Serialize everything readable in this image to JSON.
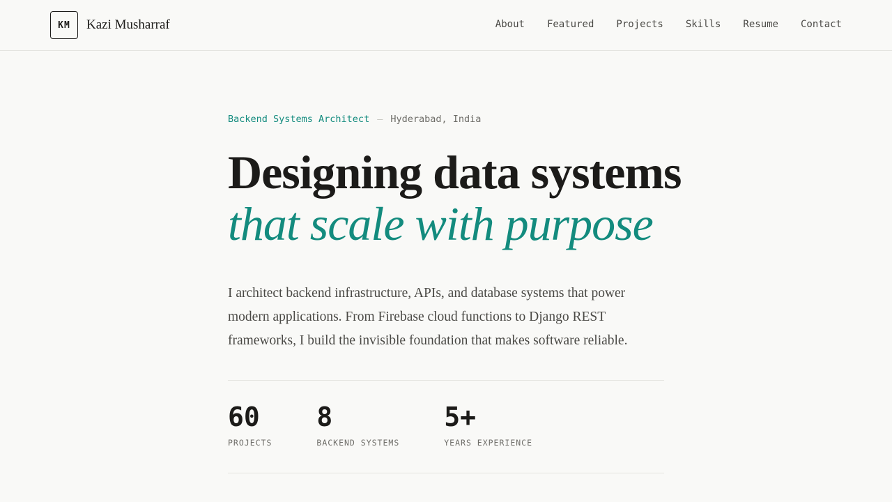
{
  "header": {
    "logo_initials": "KM",
    "logo_name": "Kazi Musharraf",
    "nav": [
      {
        "label": "About"
      },
      {
        "label": "Featured"
      },
      {
        "label": "Projects"
      },
      {
        "label": "Skills"
      },
      {
        "label": "Resume"
      },
      {
        "label": "Contact"
      }
    ]
  },
  "hero": {
    "role": "Backend Systems Architect",
    "separator": "—",
    "location": "Hyderabad, India",
    "headline_line1": "Designing data systems",
    "headline_line2": "that scale with purpose",
    "intro": "I architect backend infrastructure, APIs, and database systems that power modern applications. From Firebase cloud functions to Django REST frameworks, I build the invisible foundation that makes software reliable."
  },
  "stats": [
    {
      "value": "60",
      "label": "PROJECTS"
    },
    {
      "value": "8",
      "label": "BACKEND SYSTEMS"
    },
    {
      "value": "5+",
      "label": "YEARS EXPERIENCE"
    }
  ],
  "colors": {
    "accent": "#138b7e",
    "background": "#f9f9f7",
    "text": "#1c1b19",
    "muted": "#6e6d68"
  }
}
